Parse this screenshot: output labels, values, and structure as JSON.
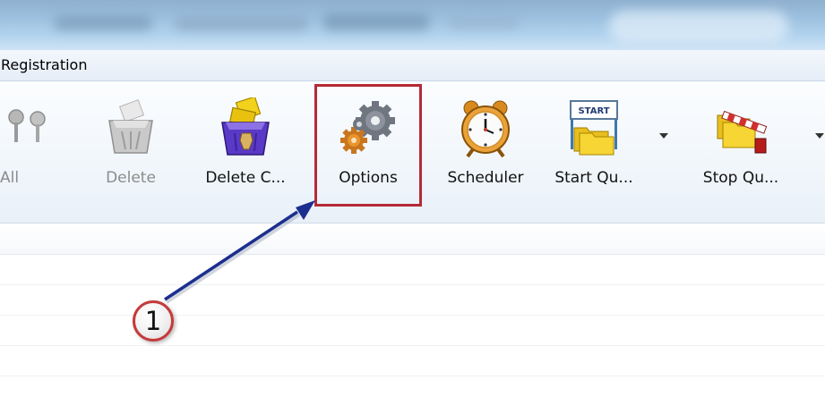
{
  "menu": {
    "registration_label": "Registration"
  },
  "toolbar": {
    "buttons": [
      {
        "label": "All",
        "state": "disabled",
        "icon": "pin-icon"
      },
      {
        "label": "Delete",
        "state": "disabled",
        "icon": "delete-bin-icon"
      },
      {
        "label": "Delete C...",
        "state": "enabled",
        "icon": "delete-completed-bin-icon"
      },
      {
        "label": "Options",
        "state": "enabled",
        "icon": "gears-icon"
      },
      {
        "label": "Scheduler",
        "state": "enabled",
        "icon": "alarm-clock-icon"
      },
      {
        "label": "Start Qu...",
        "state": "enabled",
        "icon": "start-queue-folder-icon"
      },
      {
        "label": "Stop Qu...",
        "state": "enabled",
        "icon": "stop-queue-folder-icon"
      }
    ],
    "start_sign_text": "START"
  },
  "callout": {
    "number": "1"
  },
  "colors": {
    "highlight_border": "#b52a36",
    "arrow": "#1c2f8f",
    "callout_ring": "#c43a3a"
  }
}
